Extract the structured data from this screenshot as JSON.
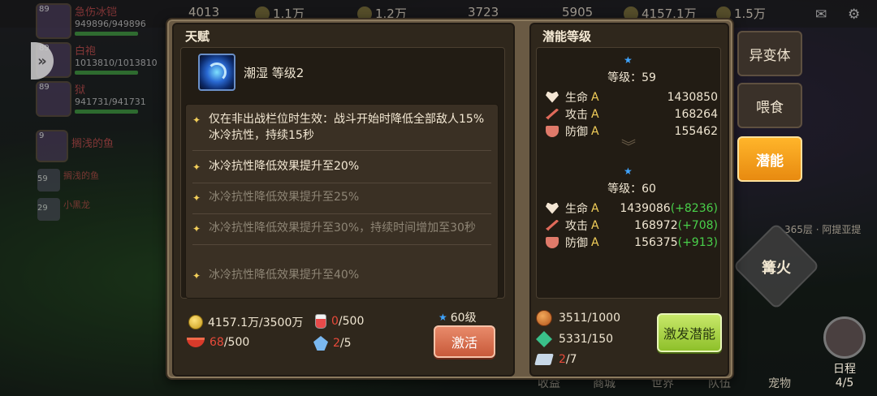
{
  "topbar": {
    "resources": [
      "4013",
      "1.1万",
      "1.2万",
      "3723",
      "5905",
      "4157.1万",
      "1.5万"
    ]
  },
  "left_list": {
    "heroes": [
      {
        "level": "89",
        "name": "急伤冰铠",
        "hp": "949896/949896"
      },
      {
        "level": "89",
        "name": "白袍",
        "hp": "1013810/1013810"
      },
      {
        "level": "89",
        "name": "狱",
        "hp": "941731/941731"
      }
    ],
    "mini": [
      {
        "level": "9",
        "name": "搁浅的鱼"
      },
      {
        "level": "59",
        "name": "搁浅的鱼"
      },
      {
        "level": "29",
        "name": "小黑龙"
      }
    ]
  },
  "talent": {
    "title": "天赋",
    "name": "潮湿 等级2",
    "effects": [
      {
        "text": "仅在非出战栏位时生效：战斗开始时降低全部敌人15%冰冷抗性，持续15秒",
        "active": true
      },
      {
        "text": "冰冷抗性降低效果提升至20%",
        "active": true
      },
      {
        "text": "冰冷抗性降低效果提升至25%",
        "active": false
      },
      {
        "text": "冰冷抗性降低效果提升至30%，持续时间增加至30秒",
        "active": false
      },
      {
        "text": "冰冷抗性降低效果提升至40%",
        "active": false
      }
    ],
    "cost_gold": {
      "have": "4157.1万",
      "need": "/3500万"
    },
    "cost_potion": {
      "have": "0",
      "need": "/500"
    },
    "cost_bowl": {
      "have": "68",
      "need": "/500"
    },
    "cost_crystal": {
      "have": "2",
      "need": "/5"
    },
    "required_level": "60级",
    "activate_label": "激活"
  },
  "potential": {
    "title": "潜能等级",
    "current": {
      "level_text": "等级：59",
      "stats": [
        {
          "label": "生命",
          "grade": "A",
          "value": "1430850"
        },
        {
          "label": "攻击",
          "grade": "A",
          "value": "168264"
        },
        {
          "label": "防御",
          "grade": "A",
          "value": "155462"
        }
      ]
    },
    "next": {
      "level_text": "等级：60",
      "stats": [
        {
          "label": "生命",
          "grade": "A",
          "value": "1439086",
          "inc": "(+8236)"
        },
        {
          "label": "攻击",
          "grade": "A",
          "value": "168972",
          "inc": "(+708)"
        },
        {
          "label": "防御",
          "grade": "A",
          "value": "156375",
          "inc": "(+913)"
        }
      ]
    },
    "mats": [
      {
        "have": "3511",
        "need": "/1000",
        "short": false
      },
      {
        "have": "5331",
        "need": "/150",
        "short": false
      },
      {
        "have": "2",
        "need": "/7",
        "short": true
      }
    ],
    "button_label": "激发潜能"
  },
  "side_tabs": {
    "mutation": "异变体",
    "feed": "喂食",
    "potential": "潜能"
  },
  "map": {
    "bonfire": "篝火",
    "location": "365层 · 阿提亚提",
    "schedule": "日程",
    "schedule_count": "4/5"
  },
  "bottom_tabs": [
    "收益",
    "商城",
    "世界",
    "队伍",
    "宠物"
  ]
}
